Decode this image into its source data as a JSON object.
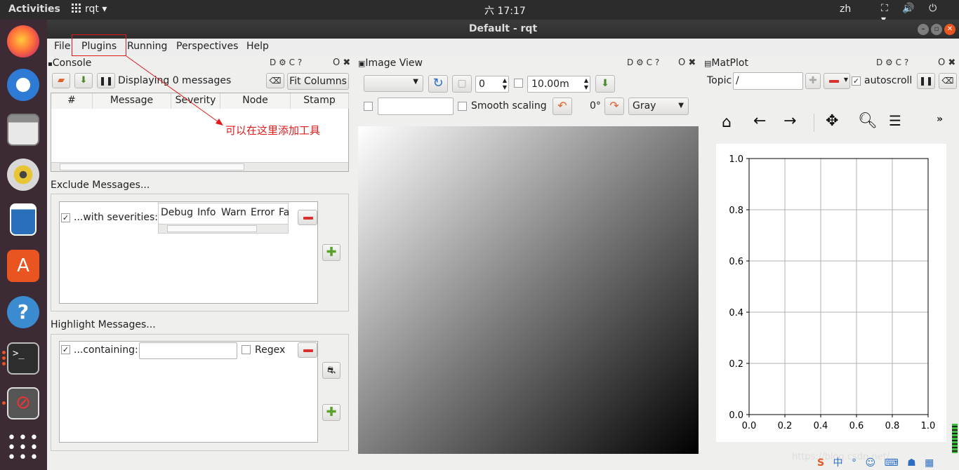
{
  "topbar": {
    "activities": "Activities",
    "app": "rqt",
    "clock": "六 17:17",
    "lang": "zh",
    "tray_icons": "⛶ 🔊 ⏻ ▾"
  },
  "window": {
    "title": "Default - rqt"
  },
  "menu": {
    "file": "File",
    "plugins": "Plugins",
    "running": "Running",
    "perspectives": "Perspectives",
    "help": "Help"
  },
  "annotation": {
    "text": "可以在这里添加工具"
  },
  "console": {
    "title": "Console",
    "status": "Displaying 0 messages",
    "fit_columns": "Fit Columns",
    "columns": [
      "#",
      "Message",
      "Severity",
      "Node",
      "Stamp"
    ],
    "exclude_title": "Exclude Messages...",
    "with_severities": "...with severities:",
    "severities": [
      "Debug",
      "Info",
      "Warn",
      "Error",
      "Fa"
    ],
    "highlight_title": "Highlight Messages...",
    "containing": "...containing:",
    "regex": "Regex"
  },
  "image_view": {
    "title": "Image View",
    "number_value": "0",
    "duration_value": "10.00m",
    "smooth_scaling": "Smooth scaling",
    "rotation": "0°",
    "colormap": "Gray"
  },
  "matplot": {
    "title": "MatPlot",
    "topic_label": "Topic",
    "topic_value": "/",
    "autoscroll": "autoscroll",
    "more": "»"
  },
  "chart_data": {
    "type": "line",
    "series": [],
    "xlim": [
      0.0,
      1.0
    ],
    "ylim": [
      0.0,
      1.0
    ],
    "xticks": [
      "0.0",
      "0.2",
      "0.4",
      "0.6",
      "0.8",
      "1.0"
    ],
    "yticks": [
      "0.0",
      "0.2",
      "0.4",
      "0.6",
      "0.8",
      "1.0"
    ],
    "grid": true
  },
  "dock_panel_buttons": "D ⚙ C ?",
  "panel_close": "O ✖",
  "watermark": "https://blog.csdn.net/..."
}
